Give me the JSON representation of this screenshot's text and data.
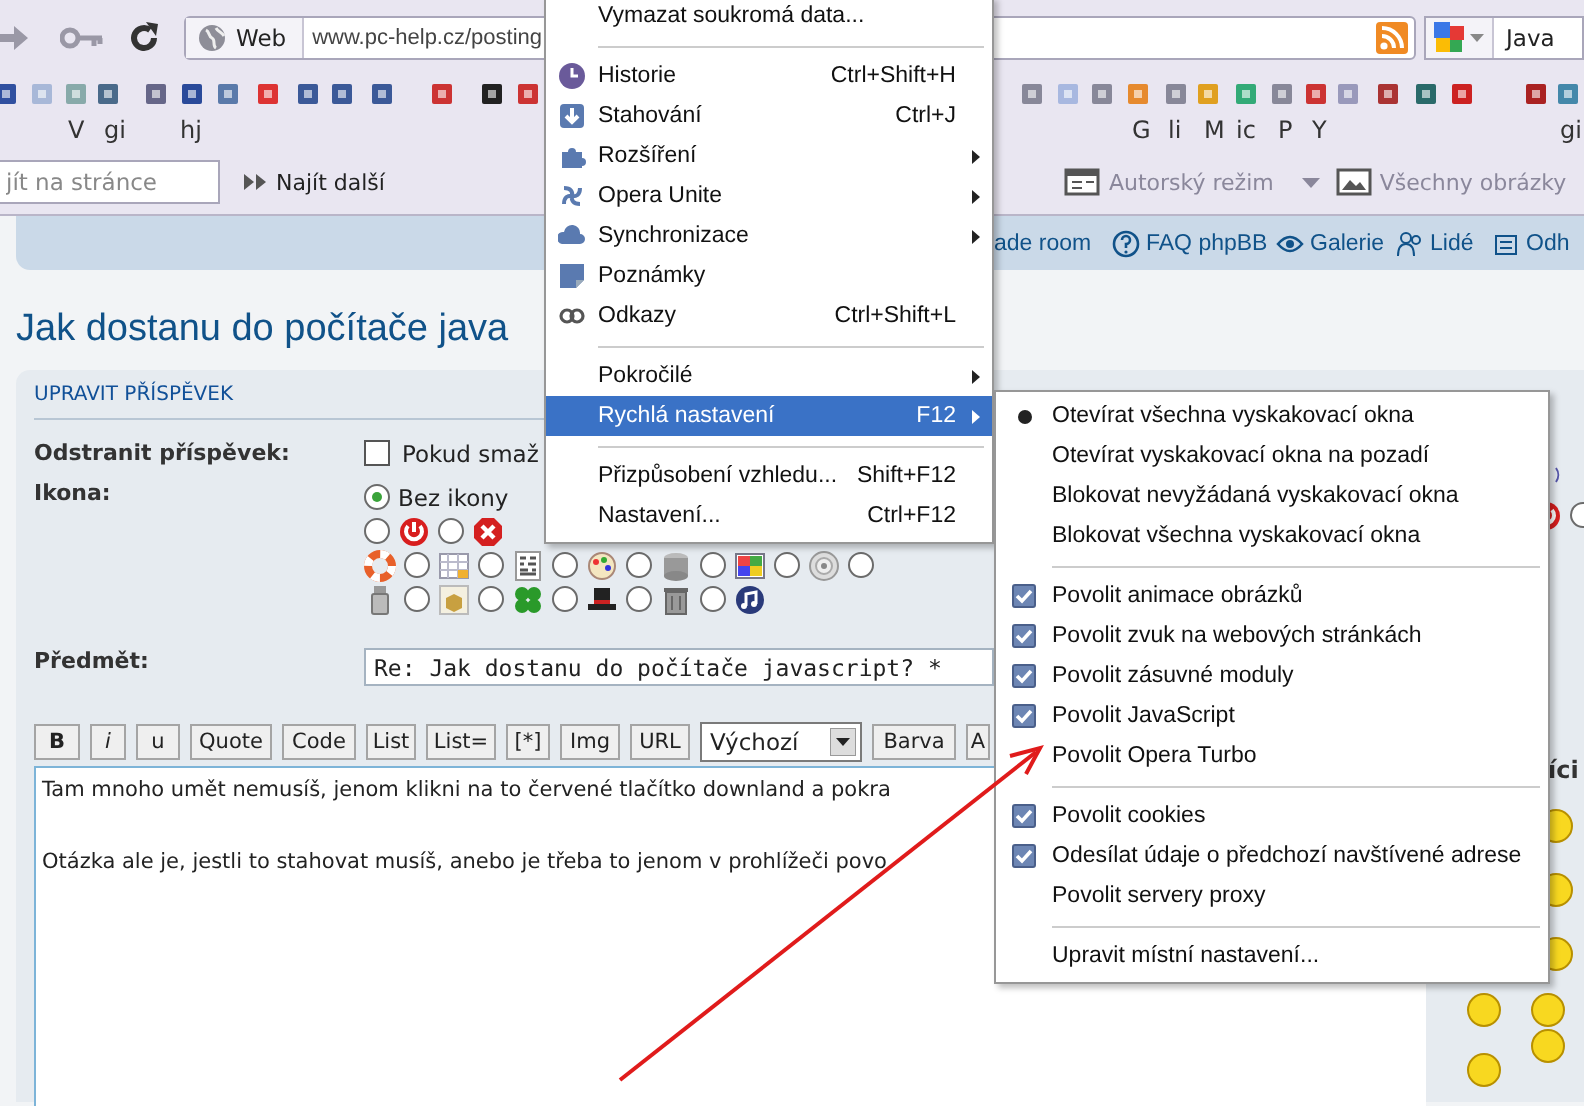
{
  "browser": {
    "address": {
      "prefix": "Web",
      "url": "www.pc-help.cz/posting"
    },
    "search": {
      "value": "Java"
    },
    "bookmarks": [
      {
        "label": "V"
      },
      {
        "label": "gi"
      },
      {
        "label": "hj"
      },
      {
        "label": "G"
      },
      {
        "label": "li"
      },
      {
        "label": "M"
      },
      {
        "label": "ic"
      },
      {
        "label": "P"
      },
      {
        "label": "Y"
      },
      {
        "label": "gi"
      }
    ],
    "find": {
      "placeholder": "jít na stránce"
    },
    "find_next": "Najít další",
    "tools": [
      "Autorský režim",
      "Všechny obrázky"
    ]
  },
  "forum": {
    "nav_links": [
      "ade room",
      "FAQ phpBB",
      "Galerie",
      "Lidé",
      "Odh"
    ],
    "title": "Jak dostanu do počítače java",
    "section": "UPRAVIT PŘÍSPĚVEK",
    "delete": {
      "label": "Odstranit příspěvek:",
      "checked": false,
      "text": "Pokud smaž"
    },
    "icon_label": "Ikona:",
    "icon_rows": [
      [
        {
          "kind": "radio",
          "selected": true,
          "label": "Bez ikony"
        }
      ],
      [
        {
          "kind": "radio",
          "selected": false
        },
        {
          "kind": "icon"
        },
        {
          "kind": "radio",
          "selected": false
        },
        {
          "kind": "icon"
        }
      ],
      [
        {
          "kind": "icon"
        },
        {
          "kind": "radio",
          "selected": false
        },
        {
          "kind": "icon"
        },
        {
          "kind": "radio",
          "selected": false
        },
        {
          "kind": "icon"
        },
        {
          "kind": "radio",
          "selected": false
        },
        {
          "kind": "icon"
        },
        {
          "kind": "radio",
          "selected": false
        },
        {
          "kind": "icon"
        },
        {
          "kind": "radio",
          "selected": false
        },
        {
          "kind": "icon"
        },
        {
          "kind": "radio",
          "selected": false
        },
        {
          "kind": "icon"
        },
        {
          "kind": "radio",
          "selected": false
        }
      ],
      [
        {
          "kind": "icon"
        },
        {
          "kind": "radio",
          "selected": false
        },
        {
          "kind": "icon"
        },
        {
          "kind": "radio",
          "selected": false
        },
        {
          "kind": "icon"
        },
        {
          "kind": "radio",
          "selected": false
        },
        {
          "kind": "icon"
        },
        {
          "kind": "radio",
          "selected": false
        },
        {
          "kind": "icon"
        },
        {
          "kind": "radio",
          "selected": false
        },
        {
          "kind": "icon"
        }
      ]
    ],
    "icon_rows_right": [
      [
        {
          "kind": "icon"
        }
      ],
      [
        {
          "kind": "icon"
        },
        {
          "kind": "radio",
          "selected": false
        }
      ]
    ],
    "subject": {
      "label": "Předmět:",
      "value": "Re: Jak dostanu do počítače javascript? *"
    },
    "toolbar": [
      {
        "kind": "button",
        "label": "B"
      },
      {
        "kind": "button",
        "label": "i"
      },
      {
        "kind": "button",
        "label": "u"
      },
      {
        "kind": "button",
        "label": "Quote"
      },
      {
        "kind": "button",
        "label": "Code"
      },
      {
        "kind": "button",
        "label": "List"
      },
      {
        "kind": "button",
        "label": "List="
      },
      {
        "kind": "button",
        "label": "[*]"
      },
      {
        "kind": "button",
        "label": "Img"
      },
      {
        "kind": "button",
        "label": "URL"
      },
      {
        "kind": "select",
        "label": "Výchozí"
      },
      {
        "kind": "button",
        "label": "Barva"
      },
      {
        "kind": "button",
        "label": "A"
      }
    ],
    "message_lines": [
      "Tam mnoho umět nemusíš, jenom klikni na to červené tlačítko downland a pokra",
      "Otázka ale je, jestli to stahovat musíš, anebo je třeba to jenom v prohlížeči povo"
    ],
    "smilies_heading": "íci"
  },
  "menu": {
    "items": [
      {
        "kind": "item",
        "label": "Vymazat soukromá data...",
        "selected": false,
        "submenu": false
      },
      {
        "kind": "separator"
      },
      {
        "kind": "item",
        "label": "Historie",
        "shortcut": "Ctrl+Shift+H",
        "selected": false,
        "submenu": false
      },
      {
        "kind": "item",
        "label": "Stahování",
        "shortcut": "Ctrl+J",
        "selected": false,
        "submenu": false
      },
      {
        "kind": "item",
        "label": "Rozšíření",
        "selected": false,
        "submenu": true
      },
      {
        "kind": "item",
        "label": "Opera Unite",
        "selected": false,
        "submenu": true
      },
      {
        "kind": "item",
        "label": "Synchronizace",
        "selected": false,
        "submenu": true
      },
      {
        "kind": "item",
        "label": "Poznámky",
        "selected": false,
        "submenu": false
      },
      {
        "kind": "item",
        "label": "Odkazy",
        "shortcut": "Ctrl+Shift+L",
        "selected": false,
        "submenu": false
      },
      {
        "kind": "separator"
      },
      {
        "kind": "item",
        "label": "Pokročilé",
        "selected": false,
        "submenu": true
      },
      {
        "kind": "item",
        "label": "Rychlá nastavení",
        "shortcut": "F12",
        "selected": true,
        "submenu": true
      },
      {
        "kind": "separator"
      },
      {
        "kind": "item",
        "label": "Přizpůsobení vzhledu...",
        "shortcut": "Shift+F12",
        "selected": false,
        "submenu": false
      },
      {
        "kind": "item",
        "label": "Nastavení...",
        "shortcut": "Ctrl+F12",
        "selected": false,
        "submenu": false
      }
    ]
  },
  "submenu": {
    "items": [
      {
        "kind": "radio",
        "label": "Otevírat všechna vyskakovací okna",
        "selected": true
      },
      {
        "kind": "radio",
        "label": "Otevírat vyskakovací okna na pozadí",
        "selected": false
      },
      {
        "kind": "radio",
        "label": "Blokovat nevyžádaná vyskakovací okna",
        "selected": false
      },
      {
        "kind": "radio",
        "label": "Blokovat všechna vyskakovací okna",
        "selected": false
      },
      {
        "kind": "separator"
      },
      {
        "kind": "check",
        "label": "Povolit animace obrázků",
        "checked": true
      },
      {
        "kind": "check",
        "label": "Povolit zvuk na webových stránkách",
        "checked": true
      },
      {
        "kind": "check",
        "label": "Povolit zásuvné moduly",
        "checked": true
      },
      {
        "kind": "check",
        "label": "Povolit JavaScript",
        "checked": true
      },
      {
        "kind": "check",
        "label": "Povolit Opera Turbo",
        "checked": false
      },
      {
        "kind": "separator"
      },
      {
        "kind": "check",
        "label": "Povolit cookies",
        "checked": true
      },
      {
        "kind": "check",
        "label": "Odesílat údaje o předchozí navštívené adrese",
        "checked": true
      },
      {
        "kind": "check",
        "label": "Povolit servery proxy",
        "checked": false
      },
      {
        "kind": "separator"
      },
      {
        "kind": "plain",
        "label": "Upravit místní nastavení..."
      }
    ]
  }
}
